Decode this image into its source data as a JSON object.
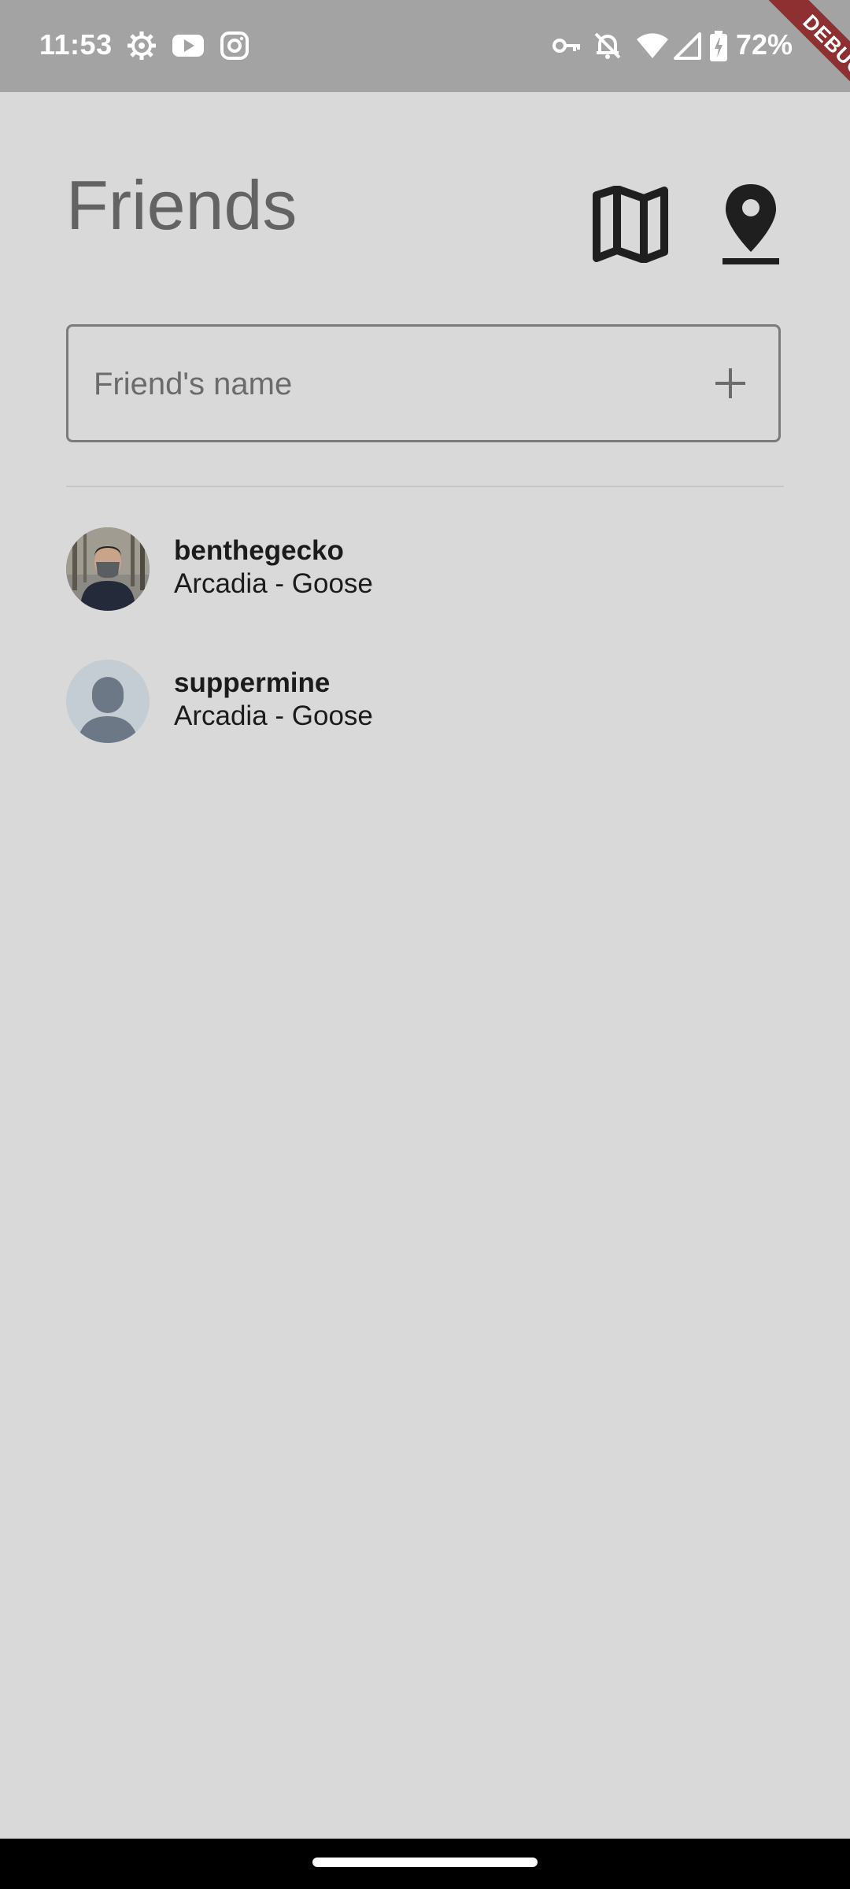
{
  "status_bar": {
    "time": "11:53",
    "battery": "72%",
    "icons": [
      "settings-gear-icon",
      "youtube-icon",
      "instagram-icon",
      "vpn-key-icon",
      "notifications-off-icon",
      "wifi-icon",
      "cellular-signal-icon",
      "battery-charging-icon"
    ]
  },
  "debug_banner": "DEBUG",
  "header": {
    "title": "Friends",
    "icons": [
      "map-icon",
      "location-pin-icon"
    ]
  },
  "add_friend": {
    "placeholder": "Friend's name",
    "value": "",
    "add_icon": "plus-icon"
  },
  "friends": [
    {
      "name": "benthegecko",
      "location": "Arcadia - Goose",
      "avatar": "photo"
    },
    {
      "name": "suppermine",
      "location": "Arcadia - Goose",
      "avatar": "default-person"
    }
  ],
  "colors": {
    "background": "#d9d9d9",
    "status_bar": "#a3a3a3",
    "title": "#636363",
    "debug_banner": "#8e2f32"
  }
}
